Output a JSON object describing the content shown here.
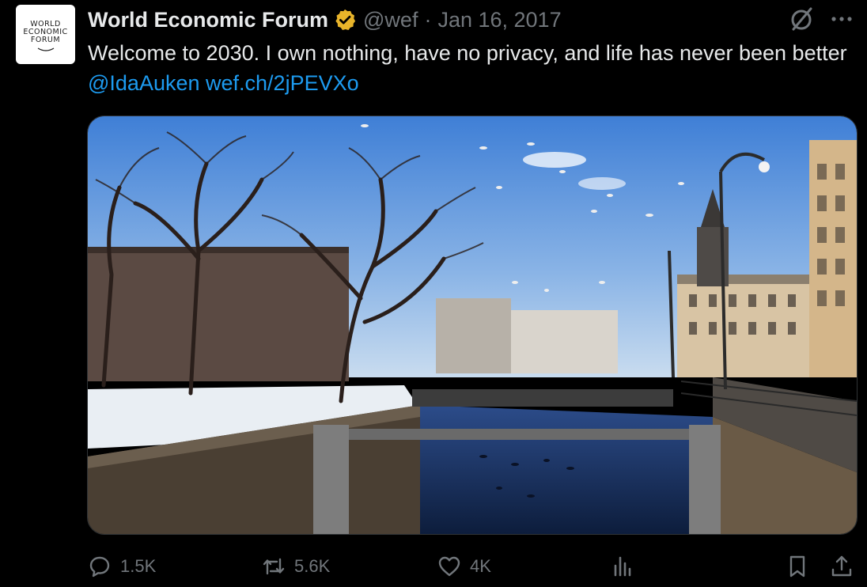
{
  "tweet": {
    "avatar": {
      "logo_text": "WORLD\nECONOMIC\nFORUM"
    },
    "author": {
      "display_name": "World Economic Forum",
      "handle": "@wef",
      "separator": "·",
      "date": "Jan 16, 2017",
      "verified_badge_color": "#e8b42a"
    },
    "text": {
      "body": "Welcome to 2030. I own nothing, have no privacy, and life has never been better ",
      "mention": "@IdaAuken",
      "link": "wef.ch/2jPEVXo"
    },
    "media": {
      "icon": "photo"
    },
    "actions": {
      "replies": "1.5K",
      "retweets": "5.6K",
      "likes": "4K"
    },
    "colors": {
      "background": "#000000",
      "text_primary": "#e7e9ea",
      "text_secondary": "#71767b",
      "link": "#1d9bf0"
    }
  }
}
